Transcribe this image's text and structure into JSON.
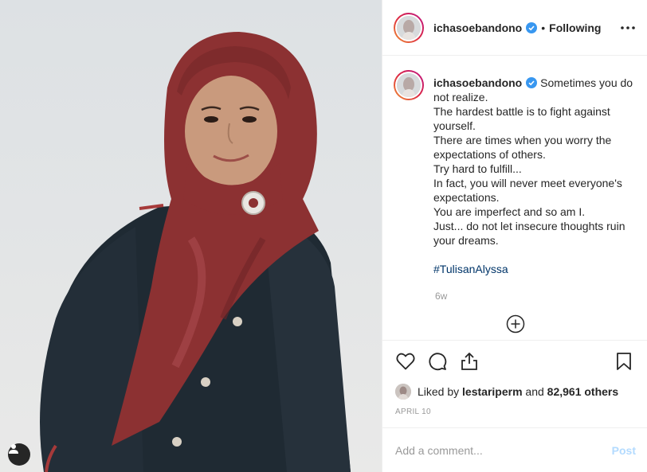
{
  "post": {
    "username": "ichasoebandono",
    "verified": true,
    "separator": "•",
    "follow_status": "Following",
    "caption": "Sometimes you do not realize.\nThe hardest battle is to fight against yourself.\nThere are times when you worry the expectations of others.\nTry hard to fulfill...\nIn fact, you will never meet everyone's expectations.\nYou are imperfect and so am I.\nJust... do not let insecure thoughts ruin your dreams.",
    "hashtag": "#TulisanAlyssa",
    "age": "6w",
    "liked_by_prefix": "Liked by",
    "liked_by_user": "lestariperm",
    "liked_and": "and",
    "liked_others": "82,961 others",
    "date": "APRIL 10"
  },
  "comment_box": {
    "placeholder": "Add a comment...",
    "post_label": "Post"
  },
  "icons": {
    "more": "more-options-icon",
    "verified": "verified-badge-icon",
    "like": "heart-icon",
    "comment": "comment-bubble-icon",
    "share": "share-icon",
    "save": "bookmark-icon",
    "load_more": "plus-circle-icon",
    "tag": "user-tag-icon"
  },
  "colors": {
    "accent": "#3897f0",
    "hashtag": "#003569",
    "post_disabled": "#b3dbff",
    "muted": "#999999",
    "text": "#262626"
  }
}
